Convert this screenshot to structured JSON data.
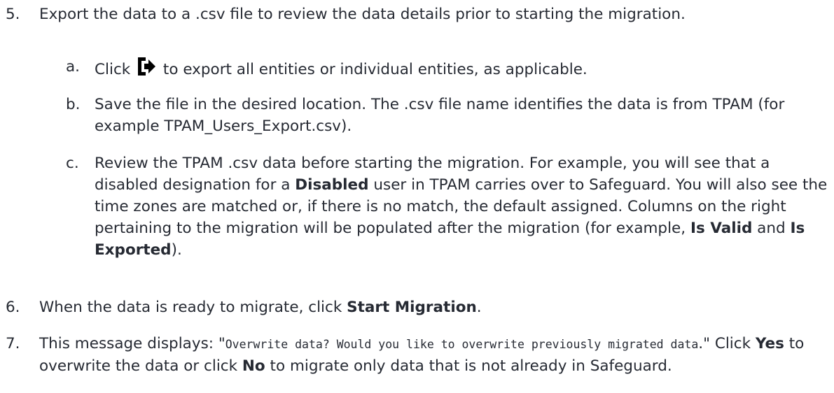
{
  "steps": [
    {
      "num": "5.",
      "text": "Export the data to a .csv file to review the data details prior to starting the migration."
    },
    {
      "num": "6.",
      "pre": "When the data is ready to migrate, click ",
      "bold": "Start Migration",
      "post": "."
    },
    {
      "num": "7.",
      "pre": "This message displays: \"",
      "mono": "Overwrite data? Would you like to overwrite previously migrated data",
      "mid": ".\" Click ",
      "bold1": "Yes",
      "mid2": " to overwrite the data or click ",
      "bold2": "No",
      "post": " to migrate only data that is not already in Safeguard."
    }
  ],
  "substeps": [
    {
      "num": "a.",
      "pre": "Click ",
      "icon": "export-icon",
      "post": " to export all entities or individual entities, as applicable."
    },
    {
      "num": "b.",
      "text": "Save the file in the desired location. The .csv file name identifies the data is from TPAM (for example TPAM_Users_Export.csv)."
    },
    {
      "num": "c.",
      "pre": "Review the TPAM .csv data before starting the migration. For example, you will see that a disabled designation for a ",
      "bold1": "Disabled",
      "mid": " user in TPAM carries over to Safeguard. You will also see the time zones are matched or, if there is no match, the default assigned. Columns on the right pertaining to the migration will be populated after the migration (for example, ",
      "bold2": "Is Valid",
      "mid2": " and ",
      "bold3": "Is Exported",
      "post": ")."
    }
  ]
}
